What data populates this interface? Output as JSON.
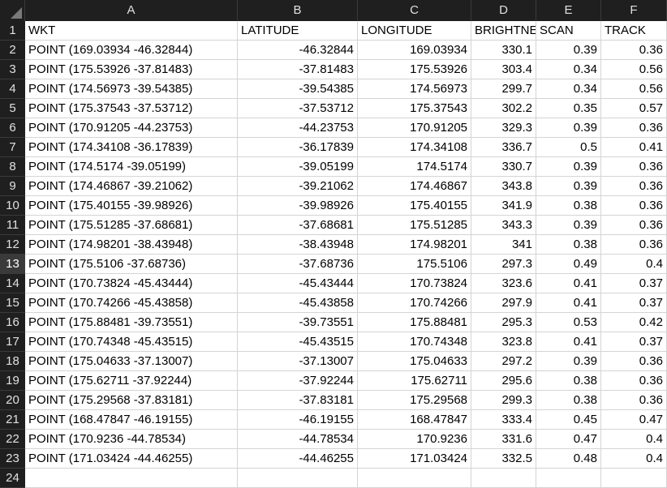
{
  "sheet": {
    "columns": [
      "A",
      "B",
      "C",
      "D",
      "E",
      "F"
    ],
    "row_numbers": [
      "1",
      "2",
      "3",
      "4",
      "5",
      "6",
      "7",
      "8",
      "9",
      "10",
      "11",
      "12",
      "13",
      "14",
      "15",
      "16",
      "17",
      "18",
      "19",
      "20",
      "21",
      "22",
      "23",
      "24"
    ],
    "header_row": [
      "WKT",
      "LATITUDE",
      "LONGITUDE",
      "BRIGHTNE",
      "SCAN",
      "TRACK"
    ],
    "rows": [
      [
        "POINT (169.03934 -46.32844)",
        "-46.32844",
        "169.03934",
        "330.1",
        "0.39",
        "0.36"
      ],
      [
        "POINT (175.53926 -37.81483)",
        "-37.81483",
        "175.53926",
        "303.4",
        "0.34",
        "0.56"
      ],
      [
        "POINT (174.56973 -39.54385)",
        "-39.54385",
        "174.56973",
        "299.7",
        "0.34",
        "0.56"
      ],
      [
        "POINT (175.37543 -37.53712)",
        "-37.53712",
        "175.37543",
        "302.2",
        "0.35",
        "0.57"
      ],
      [
        "POINT (170.91205 -44.23753)",
        "-44.23753",
        "170.91205",
        "329.3",
        "0.39",
        "0.36"
      ],
      [
        "POINT (174.34108 -36.17839)",
        "-36.17839",
        "174.34108",
        "336.7",
        "0.5",
        "0.41"
      ],
      [
        "POINT (174.5174 -39.05199)",
        "-39.05199",
        "174.5174",
        "330.7",
        "0.39",
        "0.36"
      ],
      [
        "POINT (174.46867 -39.21062)",
        "-39.21062",
        "174.46867",
        "343.8",
        "0.39",
        "0.36"
      ],
      [
        "POINT (175.40155 -39.98926)",
        "-39.98926",
        "175.40155",
        "341.9",
        "0.38",
        "0.36"
      ],
      [
        "POINT (175.51285 -37.68681)",
        "-37.68681",
        "175.51285",
        "343.3",
        "0.39",
        "0.36"
      ],
      [
        "POINT (174.98201 -38.43948)",
        "-38.43948",
        "174.98201",
        "341",
        "0.38",
        "0.36"
      ],
      [
        "POINT (175.5106 -37.68736)",
        "-37.68736",
        "175.5106",
        "297.3",
        "0.49",
        "0.4"
      ],
      [
        "POINT (170.73824 -45.43444)",
        "-45.43444",
        "170.73824",
        "323.6",
        "0.41",
        "0.37"
      ],
      [
        "POINT (170.74266 -45.43858)",
        "-45.43858",
        "170.74266",
        "297.9",
        "0.41",
        "0.37"
      ],
      [
        "POINT (175.88481 -39.73551)",
        "-39.73551",
        "175.88481",
        "295.3",
        "0.53",
        "0.42"
      ],
      [
        "POINT (170.74348 -45.43515)",
        "-45.43515",
        "170.74348",
        "323.8",
        "0.41",
        "0.37"
      ],
      [
        "POINT (175.04633 -37.13007)",
        "-37.13007",
        "175.04633",
        "297.2",
        "0.39",
        "0.36"
      ],
      [
        "POINT (175.62711 -37.92244)",
        "-37.92244",
        "175.62711",
        "295.6",
        "0.38",
        "0.36"
      ],
      [
        "POINT (175.29568 -37.83181)",
        "-37.83181",
        "175.29568",
        "299.3",
        "0.38",
        "0.36"
      ],
      [
        "POINT (168.47847 -46.19155)",
        "-46.19155",
        "168.47847",
        "333.4",
        "0.45",
        "0.47"
      ],
      [
        "POINT (170.9236 -44.78534)",
        "-44.78534",
        "170.9236",
        "331.6",
        "0.47",
        "0.4"
      ],
      [
        "POINT (171.03424 -44.46255)",
        "-44.46255",
        "171.03424",
        "332.5",
        "0.48",
        "0.4"
      ]
    ],
    "selected_row": "13"
  }
}
